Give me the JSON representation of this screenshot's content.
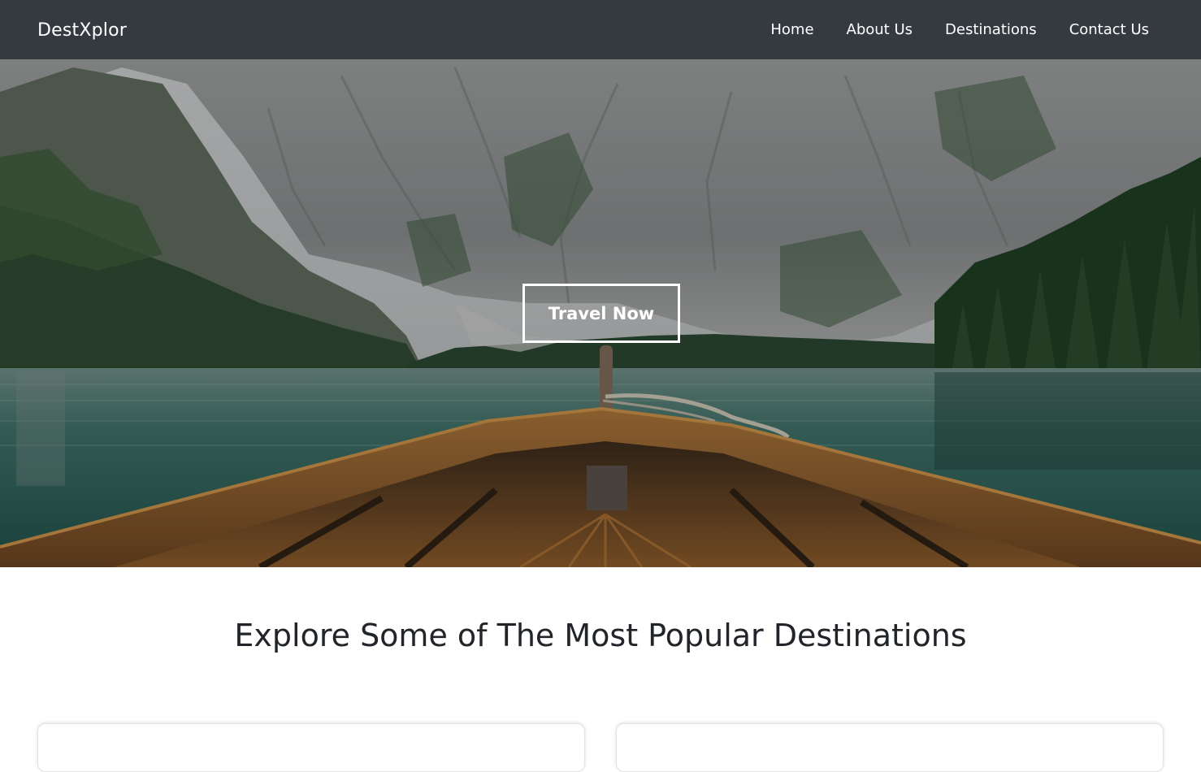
{
  "navbar": {
    "brand": "DestXplor",
    "links": [
      {
        "label": "Home"
      },
      {
        "label": "About Us"
      },
      {
        "label": "Destinations"
      },
      {
        "label": "Contact Us"
      }
    ]
  },
  "hero": {
    "cta_label": "Travel Now",
    "image_subject": "mountain lake viewed from wooden boat bow"
  },
  "destinations": {
    "title": "Explore Some of The Most Popular Destinations",
    "cards": [
      {},
      {}
    ]
  },
  "colors": {
    "navbar_bg": "#343a40",
    "text_dark": "#212529",
    "cta_border": "#ffffff"
  }
}
